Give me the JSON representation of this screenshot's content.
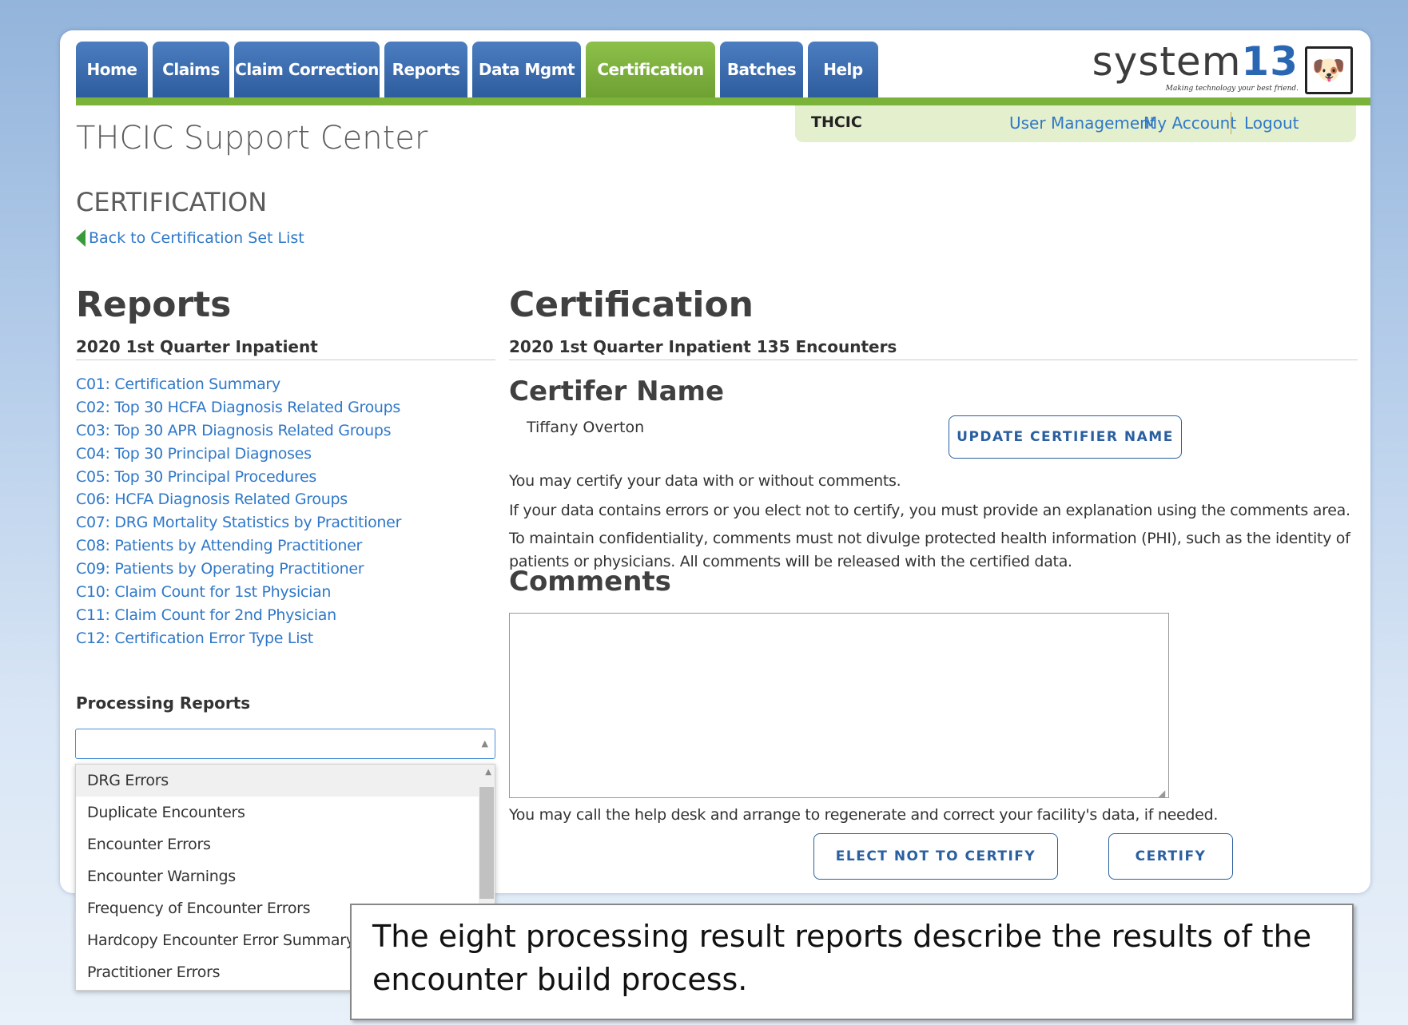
{
  "nav": {
    "tabs": [
      "Home",
      "Claims",
      "Claim Correction",
      "Reports",
      "Data Mgmt",
      "Certification",
      "Batches",
      "Help"
    ],
    "active": "Certification"
  },
  "logo": {
    "text_main": "system",
    "text_num": "13",
    "tagline": "Making technology your best friend."
  },
  "userbar": {
    "org": "THCIC",
    "user_management": "User Management",
    "my_account": "My Account",
    "logout": "Logout"
  },
  "header": {
    "site_title": "THCIC Support Center",
    "section": "CERTIFICATION",
    "back_link": "Back to Certification Set List"
  },
  "reports": {
    "title": "Reports",
    "subtitle": "2020 1st Quarter Inpatient",
    "items": [
      "C01: Certification Summary",
      "C02: Top 30 HCFA Diagnosis Related Groups",
      "C03: Top 30 APR Diagnosis Related Groups",
      "C04: Top 30 Principal Diagnoses",
      "C05: Top 30 Principal Procedures",
      "C06: HCFA Diagnosis Related Groups",
      "C07: DRG Mortality Statistics by Practitioner",
      "C08: Patients by Attending Practitioner",
      "C09: Patients by Operating Practitioner",
      "C10: Claim Count for 1st Physician",
      "C11: Claim Count for 2nd Physician",
      "C12: Certification Error Type List"
    ]
  },
  "processing": {
    "title": "Processing Reports",
    "selected": "",
    "options": [
      "DRG Errors",
      "Duplicate Encounters",
      "Encounter Errors",
      "Encounter Warnings",
      "Frequency of Encounter Errors",
      "Hardcopy Encounter Error Summary",
      "Practitioner Errors"
    ]
  },
  "certification": {
    "title": "Certification",
    "subtitle": "2020 1st Quarter Inpatient 135 Encounters",
    "certifier_heading": "Certifer Name",
    "certifier_name": "Tiffany Overton",
    "update_button": "UPDATE CERTIFIER NAME",
    "para1": "You may certify your data with or without comments.",
    "para2": "If your data contains errors or you elect not to certify, you must provide an explanation using the comments area.",
    "para3a": "To maintain confidentiality, comments must not divulge protected health information (PHI), such as the identity of",
    "para3b": "patients or physicians. All comments will be released with the certified data.",
    "comments_heading": "Comments",
    "comments_value": "",
    "help_text": "You may call the help desk and arrange to regenerate and correct your facility's data, if needed.",
    "elect_not_button": "ELECT NOT TO CERTIFY",
    "certify_button": "CERTIFY"
  },
  "callout": {
    "line1": "The eight processing result reports describe the results of the",
    "line2": "encounter build process."
  }
}
